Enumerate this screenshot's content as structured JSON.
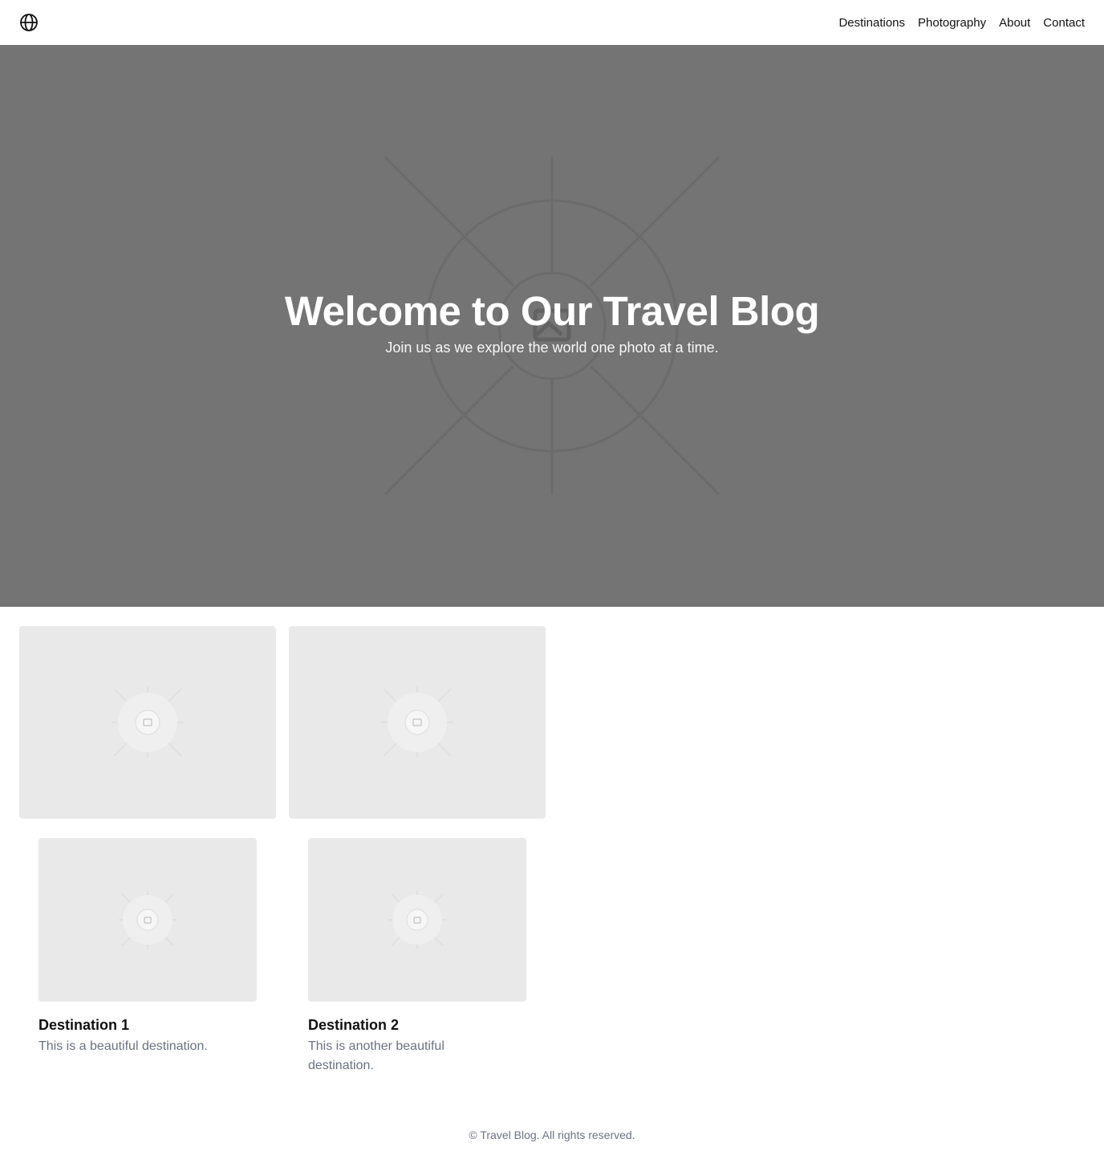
{
  "header": {
    "logo_icon": "globe-icon",
    "nav": [
      "Destinations",
      "Photography",
      "About",
      "Contact"
    ]
  },
  "hero": {
    "title": "Welcome to Our Travel Blog",
    "subtitle": "Join us as we explore the world one photo at a time.",
    "background_color": "#747474",
    "image_icon": "image-placeholder-icon"
  },
  "gallery": {
    "placeholder_icon": "image-placeholder-icon"
  },
  "destinations": [
    {
      "title": "Destination 1",
      "description": "This is a beautiful destination."
    },
    {
      "title": "Destination 2",
      "description": "This is another beautiful destination."
    }
  ],
  "footer": {
    "text": "© Travel Blog. All rights reserved."
  },
  "colors": {
    "placeholder_bg": "#e9e9e9",
    "muted_text": "#6b7280"
  }
}
